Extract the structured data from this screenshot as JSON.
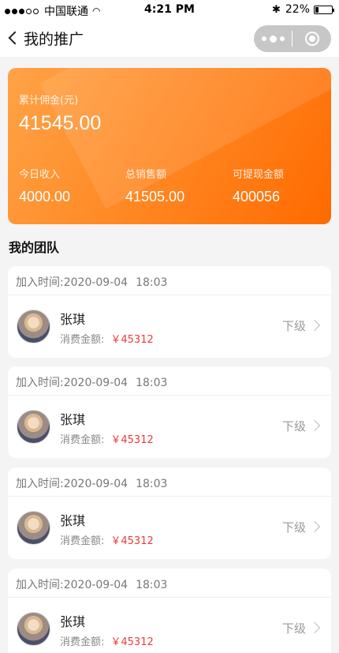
{
  "status_bar": {
    "carrier": "中国联通",
    "time": "4:21 PM",
    "battery": "22%",
    "battery_level": 0.22
  },
  "nav": {
    "title": "我的推广"
  },
  "stats": {
    "total_label": "累计佣金(元)",
    "total_value": "41545.00",
    "today_label": "今日收入",
    "today_value": "4000.00",
    "sales_label": "总销售额",
    "sales_value": "41505.00",
    "withdrawable_label": "可提现金额",
    "withdrawable_value": "400056"
  },
  "team": {
    "title": "我的团队",
    "members": [
      {
        "join_label": "加入时间:2020-09-04",
        "join_time": "18:03",
        "name": "张琪",
        "spend_label": "消费金额:",
        "spend_amount": "￥45312",
        "level": "下级"
      },
      {
        "join_label": "加入时间:2020-09-04",
        "join_time": "18:03",
        "name": "张琪",
        "spend_label": "消费金额:",
        "spend_amount": "￥45312",
        "level": "下级"
      },
      {
        "join_label": "加入时间:2020-09-04",
        "join_time": "18:03",
        "name": "张琪",
        "spend_label": "消费金额:",
        "spend_amount": "￥45312",
        "level": "下级"
      },
      {
        "join_label": "加入时间:2020-09-04",
        "join_time": "18:03",
        "name": "张琪",
        "spend_label": "消费金额:",
        "spend_amount": "￥45312",
        "level": "下级"
      }
    ]
  }
}
